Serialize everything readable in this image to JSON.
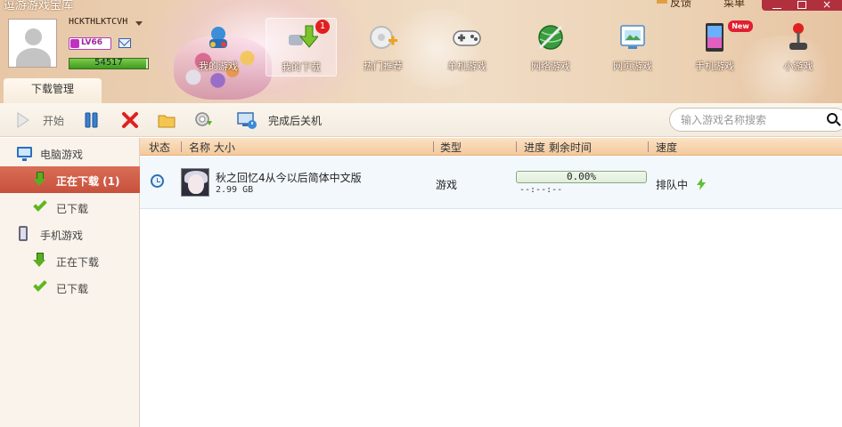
{
  "app": {
    "title": "逗游游戏宝库"
  },
  "top_links": {
    "feedback": "反馈",
    "menu": "菜单"
  },
  "user": {
    "name": "HCKTHLKTCVH",
    "level": "LV66",
    "exp": "54517",
    "exp_fraction": 0.98
  },
  "nav": {
    "badge_count": "1",
    "new_badge": "New",
    "items": [
      {
        "label": "我的游戏",
        "icon": "my-games-icon"
      },
      {
        "label": "我的下载",
        "icon": "my-downloads-icon"
      },
      {
        "label": "热门推荐",
        "icon": "hot-recommend-icon"
      },
      {
        "label": "单机游戏",
        "icon": "gamepad-icon"
      },
      {
        "label": "网络游戏",
        "icon": "globe-sword-icon"
      },
      {
        "label": "网页游戏",
        "icon": "web-game-icon"
      },
      {
        "label": "手机游戏",
        "icon": "tablet-icon"
      },
      {
        "label": "小游戏",
        "icon": "joystick-icon"
      }
    ]
  },
  "main_tab": {
    "label": "下载管理"
  },
  "toolbar": {
    "start_label": "开始",
    "shutdown_label": "完成后关机"
  },
  "search": {
    "placeholder": "输入游戏名称搜索"
  },
  "sidebar": {
    "pc": {
      "label": "电脑游戏",
      "downloading": "正在下载 (1)",
      "downloaded": "已下载"
    },
    "mobile": {
      "label": "手机游戏",
      "downloading": "正在下载",
      "downloaded": "已下载"
    }
  },
  "table": {
    "headers": {
      "status": "状态",
      "name": "名称 大小",
      "type": "类型",
      "progress": "进度 剩余时间",
      "speed": "速度"
    },
    "rows": [
      {
        "name": "秋之回忆4从今以后简体中文版",
        "size": "2.99 GB",
        "type": "游戏",
        "progress": "0.00%",
        "progress_fraction": 0.0,
        "time_left": "--:--:--",
        "speed": "排队中"
      }
    ]
  },
  "colors": {
    "accent_red": "#c7513d",
    "progress_green": "#6cc040",
    "header_peach": "#f3c99d"
  }
}
